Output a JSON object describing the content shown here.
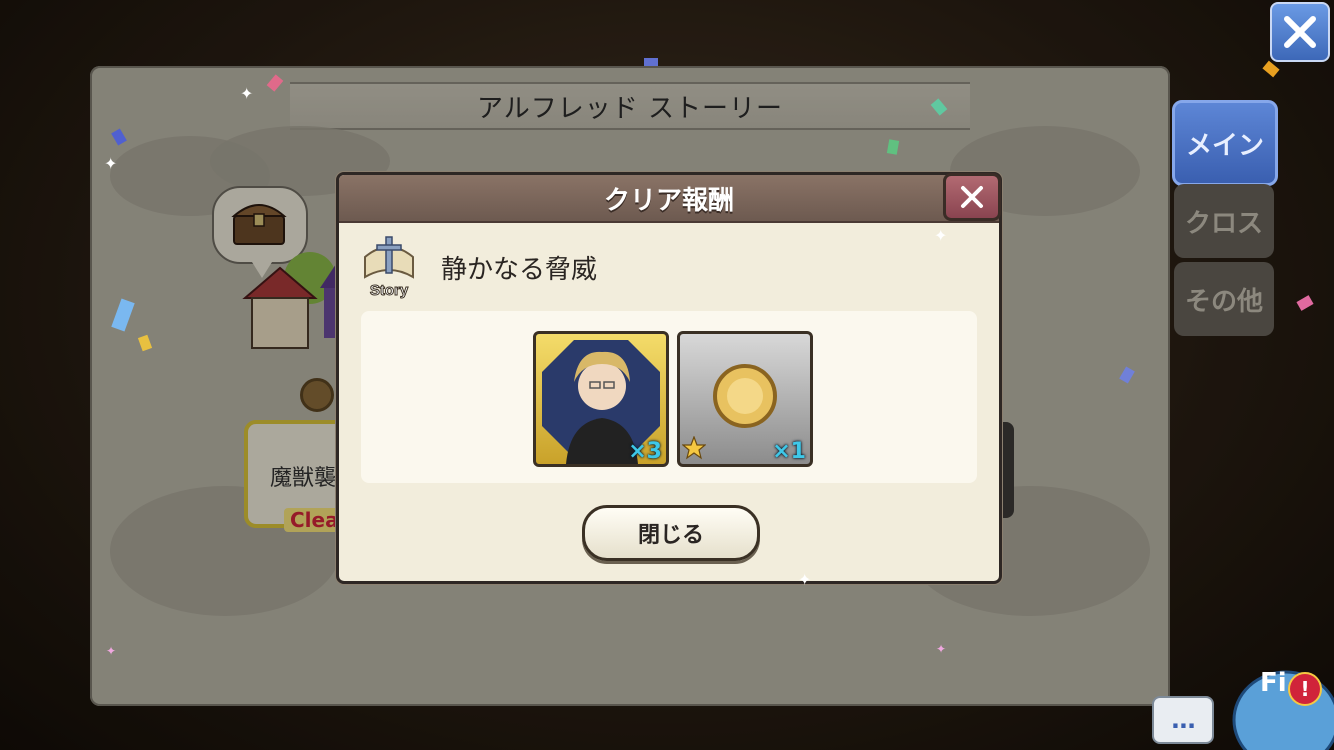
{
  "background": {
    "panel_title": "アルフレッド ストーリー",
    "stage_label": "魔獣襲",
    "clear_label": "Clea"
  },
  "side_tabs": [
    {
      "label": "メイン",
      "active": true
    },
    {
      "label": "クロス",
      "active": false
    },
    {
      "label": "その他",
      "active": false
    }
  ],
  "top_close_icon": "close-icon",
  "field_button": {
    "label": "Fi",
    "alert": "!"
  },
  "chat_button": {
    "label": "..."
  },
  "dialog": {
    "title": "クリア報酬",
    "close_icon": "close-icon",
    "story_badge": "Story",
    "quest_name": "静かなる脅威",
    "rewards": [
      {
        "type": "character",
        "quantity": "×3",
        "colors": {
          "bg": "#e8c84a"
        }
      },
      {
        "type": "coin",
        "quantity": "×1",
        "rarity": 1
      }
    ],
    "close_button": "閉じる"
  },
  "colors": {
    "tab_active": "#4a70c4",
    "dialog_header": "#7a655a",
    "quantity_text": "#3ec8e8",
    "clear_text": "#d0243a"
  }
}
